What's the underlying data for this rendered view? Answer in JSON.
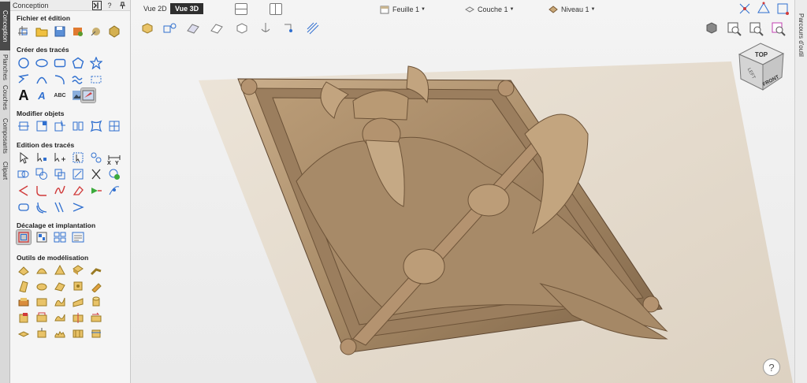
{
  "panel": {
    "title": "Conception",
    "help": "?",
    "sections": {
      "file": "Fichier et édition",
      "create": "Créer des tracés",
      "modify": "Modifier objets",
      "edit": "Edition des tracés",
      "offset": "Décalage et implantation",
      "modeling": "Outils de modélisation"
    },
    "text_tool_labels": {
      "big_a": "A",
      "small_a": "A",
      "abc": "ABC",
      "x": "X",
      "y": "Y"
    }
  },
  "left_tabs": [
    "Conception",
    "Planches",
    "Couches",
    "Composants",
    "Clipart"
  ],
  "right_tab": "Parcours d'outil",
  "view_tabs": {
    "two_d": "Vue 2D",
    "three_d": "Vue 3D"
  },
  "dropdowns": {
    "sheet": "Feuille 1",
    "layer": "Couche 1",
    "level": "Niveau 1"
  },
  "view_cube": {
    "top": "TOP",
    "front": "FRONT",
    "left": "LEFT"
  },
  "help_button": "?",
  "colors": {
    "accent": "#2f6fcf",
    "active_tab": "#2e2e2e",
    "relief": "#b89b78",
    "sheet": "#e6ddd0"
  }
}
